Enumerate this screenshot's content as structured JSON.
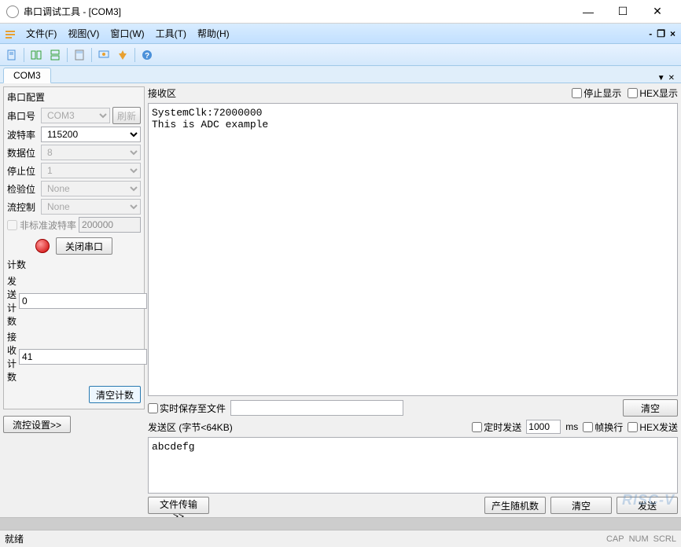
{
  "window": {
    "title": "串口调试工具 - [COM3]",
    "minimize": "—",
    "maximize": "☐",
    "close": "✕"
  },
  "menu": {
    "file": "文件(F)",
    "view": "视图(V)",
    "window": "窗口(W)",
    "tools": "工具(T)",
    "help": "帮助(H)"
  },
  "tab": {
    "label": "COM3"
  },
  "serial_config": {
    "title": "串口配置",
    "port_label": "串口号",
    "port_value": "COM3",
    "refresh": "刷新",
    "baud_label": "波特率",
    "baud_value": "115200",
    "data_label": "数据位",
    "data_value": "8",
    "stop_label": "停止位",
    "stop_value": "1",
    "parity_label": "检验位",
    "parity_value": "None",
    "flow_label": "流控制",
    "flow_value": "None",
    "nonstd_label": "非标准波特率",
    "nonstd_value": "200000",
    "close_port": "关闭串口"
  },
  "counters": {
    "title": "计数",
    "tx_label": "发送计数",
    "tx_value": "0",
    "rx_label": "接收计数",
    "rx_value": "41",
    "clear": "清空计数"
  },
  "flow_settings": "流控设置>>",
  "rx": {
    "label": "接收区",
    "stop_display": "停止显示",
    "hex_display": "HEX显示",
    "content": "SystemClk:72000000\nThis is ADC example",
    "save_label": "实时保存至文件",
    "clear": "清空"
  },
  "tx": {
    "label": "发送区 (字节<64KB)",
    "timed_send": "定时发送",
    "ms_value": "1000",
    "ms_unit": "ms",
    "frame_wrap": "帧换行",
    "hex_send": "HEX发送",
    "content": "abcdefg",
    "file_transfer": "文件传输>>",
    "random": "产生随机数",
    "clear": "清空",
    "send": "发送"
  },
  "status": {
    "ready": "就绪",
    "cap": "CAP",
    "num": "NUM",
    "scrl": "SCRL"
  },
  "watermark": "RISC-V"
}
